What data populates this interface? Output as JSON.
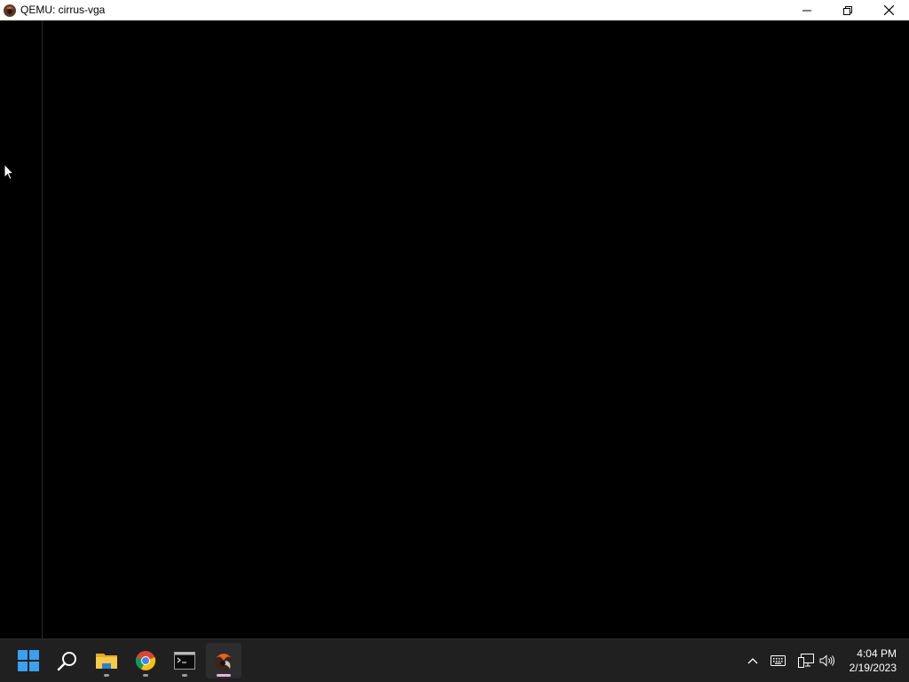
{
  "window": {
    "title": "QEMU: cirrus-vga",
    "controls": {
      "minimize_icon": "minimize-icon",
      "restore_icon": "restore-icon",
      "close_icon": "close-icon"
    }
  },
  "screen": {
    "background": "#000000"
  },
  "taskbar": {
    "apps": [
      {
        "name": "start",
        "icon": "windows-logo-icon"
      },
      {
        "name": "search",
        "icon": "search-icon"
      },
      {
        "name": "file-explorer",
        "icon": "folder-icon"
      },
      {
        "name": "chrome",
        "icon": "chrome-icon"
      },
      {
        "name": "terminal",
        "icon": "terminal-icon"
      },
      {
        "name": "qemu",
        "icon": "qemu-icon"
      }
    ],
    "tray": {
      "chevron": "chevron-up-icon",
      "keyboard": "keyboard-icon",
      "network": "network-icon",
      "volume": "volume-icon"
    },
    "clock": {
      "time": "4:04 PM",
      "date": "2/19/2023"
    }
  }
}
